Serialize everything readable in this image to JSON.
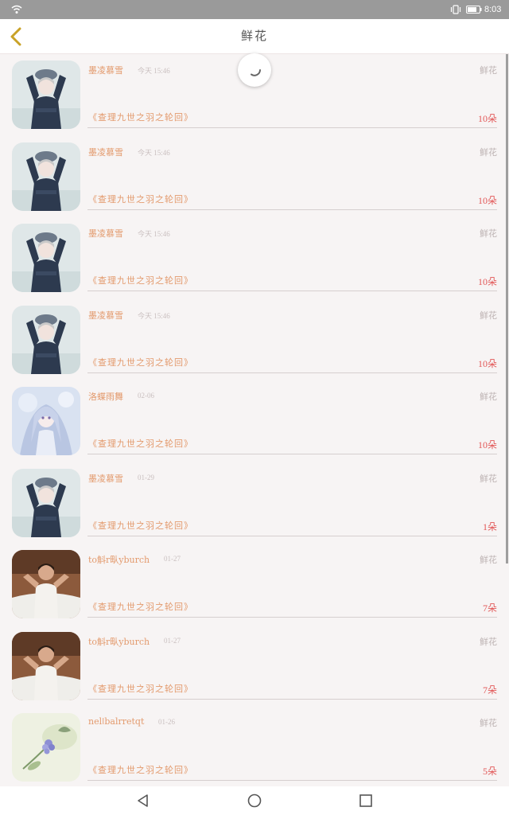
{
  "status_bar": {
    "time": "8:03",
    "icons": [
      "wifi-icon",
      "vibrate-icon",
      "battery-icon"
    ]
  },
  "header": {
    "back_icon": "chevron-left-icon",
    "title": "鲜花"
  },
  "gift_records": [
    {
      "username": "墨凌慕雪",
      "time": "今天 15:46",
      "gift_type": "鲜花",
      "book_title": "《查理九世之羽之轮回》",
      "count": "10朵",
      "avatar": "avatar-girl-dark"
    },
    {
      "username": "墨凌慕雪",
      "time": "今天 15:46",
      "gift_type": "鲜花",
      "book_title": "《查理九世之羽之轮回》",
      "count": "10朵",
      "avatar": "avatar-girl-dark"
    },
    {
      "username": "墨凌慕雪",
      "time": "今天 15:46",
      "gift_type": "鲜花",
      "book_title": "《查理九世之羽之轮回》",
      "count": "10朵",
      "avatar": "avatar-girl-dark"
    },
    {
      "username": "墨凌慕雪",
      "time": "今天 15:46",
      "gift_type": "鲜花",
      "book_title": "《查理九世之羽之轮回》",
      "count": "10朵",
      "avatar": "avatar-girl-dark"
    },
    {
      "username": "洛蝶雨舞",
      "time": "02-06",
      "gift_type": "鲜花",
      "book_title": "《查理九世之羽之轮回》",
      "count": "10朵",
      "avatar": "avatar-anime-girl"
    },
    {
      "username": "墨凌慕雪",
      "time": "01-29",
      "gift_type": "鲜花",
      "book_title": "《查理九世之羽之轮回》",
      "count": "1朵",
      "avatar": "avatar-girl-dark"
    },
    {
      "username": "to斛r㽗yburch",
      "time": "01-27",
      "gift_type": "鲜花",
      "book_title": "《查理九世之羽之轮回》",
      "count": "7朵",
      "avatar": "avatar-man"
    },
    {
      "username": "to斛r㽗yburch",
      "time": "01-27",
      "gift_type": "鲜花",
      "book_title": "《查理九世之羽之轮回》",
      "count": "7朵",
      "avatar": "avatar-man"
    },
    {
      "username": "nelǀbalrretqt",
      "time": "01-26",
      "gift_type": "鲜花",
      "book_title": "《查理九世之羽之轮回》",
      "count": "5朵",
      "avatar": "avatar-flower"
    }
  ],
  "nav_bar": {
    "icons": [
      "back-triangle-icon",
      "home-circle-icon",
      "recents-square-icon"
    ]
  },
  "colors": {
    "accent_text": "#e39a6d",
    "count_text": "#e25858",
    "status_bar": "#9a9a9a"
  }
}
